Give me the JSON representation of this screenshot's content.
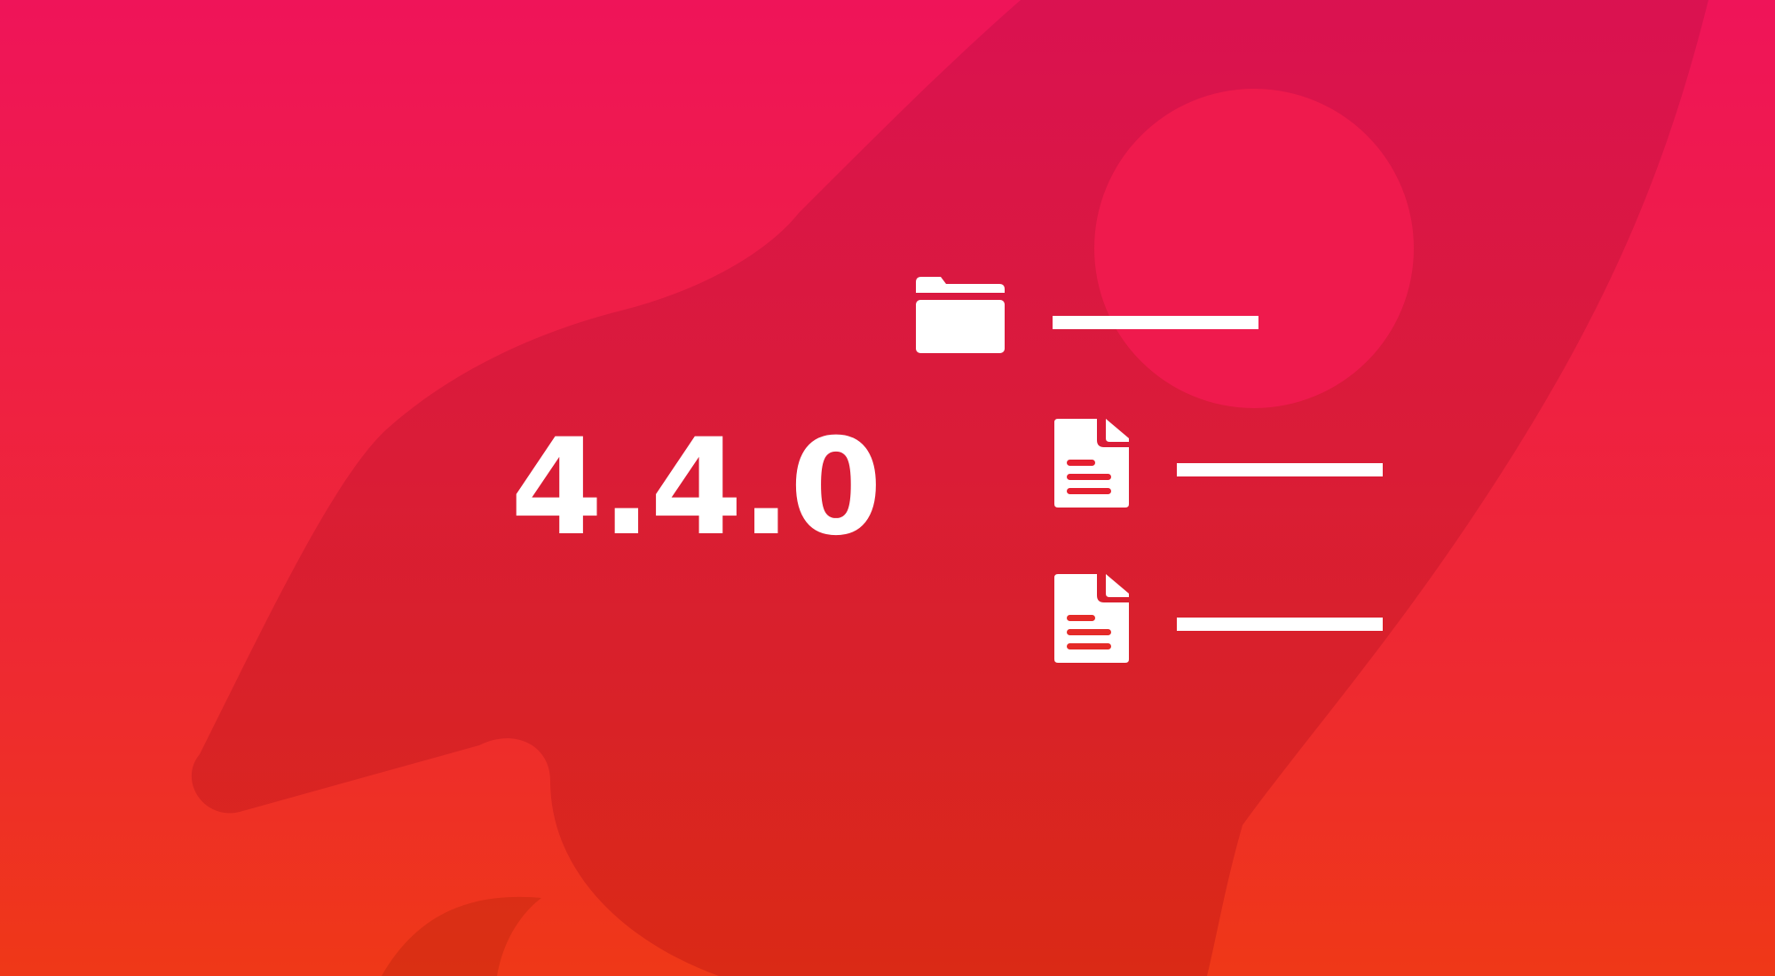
{
  "banner": {
    "version": "4.4.0",
    "colors": {
      "gradient_top": "#ef1459",
      "gradient_bottom": "#ef3817",
      "foreground": "#ffffff"
    }
  },
  "tree": {
    "items": [
      {
        "icon": "folder-icon"
      },
      {
        "icon": "file-icon"
      },
      {
        "icon": "file-icon"
      }
    ]
  }
}
